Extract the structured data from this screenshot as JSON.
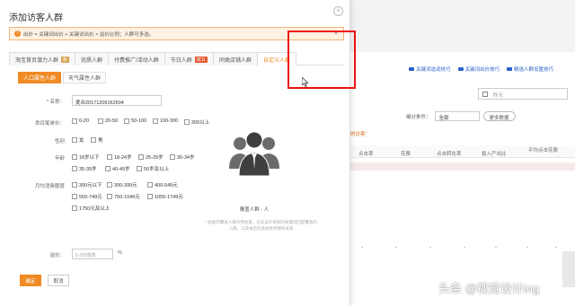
{
  "modal": {
    "title": "添加访客人群",
    "close": "×",
    "warning": {
      "text": "出价 = 关键词出价 + 关键词出价 × 溢价比例；人群可多选。",
      "close": "×"
    },
    "tabs": [
      {
        "label": "淘宝首页潜力人群",
        "badge": "新"
      },
      {
        "label": "优质人群",
        "badge": ""
      },
      {
        "label": "付费推广/活动人群",
        "badge": ""
      },
      {
        "label": "节日人群",
        "badge": "双11"
      },
      {
        "label": "同类店铺人群",
        "badge": ""
      },
      {
        "label": "自定义人群",
        "badge": ""
      }
    ],
    "subtabs": [
      "人口属性人群",
      "天气属性人群"
    ],
    "form": {
      "name_label": "* 名称：",
      "name_value": "爱众20171209162604",
      "category_price_label": "类目笔单价：",
      "category_price_options": [
        "0-20",
        "20-50",
        "50-100",
        "100-300",
        "300以上"
      ],
      "gender_label": "性别",
      "gender_options": [
        "女",
        "男"
      ],
      "age_label": "年龄",
      "age_options": [
        "18岁以下",
        "18-24岁",
        "25-29岁",
        "30-34岁",
        "35-39岁",
        "40-49岁",
        "50岁及以上"
      ],
      "spend_label": "月均消费额度",
      "spend_options": [
        "300元以下",
        "300-399元",
        "400-549元",
        "550-749元",
        "750-1049元",
        "1050-1749元",
        "1750元及以上"
      ],
      "premium_label": "溢价：",
      "premium_placeholder": "5-300整数",
      "premium_unit": "%"
    },
    "preview": {
      "count_label": "覆盖人群 - 人",
      "hint": "* 此处的覆盖人群为预估值，与您设计添加的关键词匹配覆盖的人群，以及本店的具体条件都有关系"
    },
    "buttons": {
      "ok": "确定",
      "cancel": "取消"
    }
  },
  "background": {
    "tips": [
      "关键词选词技巧",
      "关键词出价技巧",
      "精选人群设置技巧"
    ],
    "date_placeholder": "昨天",
    "filter_label": "细分条件：",
    "filter_value": "全部",
    "more_data": "更多数据",
    "note": "的访客\"",
    "columns": [
      "点击率",
      "花费",
      "点击转化率",
      "投入产出比",
      "平均点击花费"
    ],
    "dashes": [
      "-",
      "-",
      "-",
      "-",
      "-",
      "-",
      "-"
    ]
  },
  "watermark": "头条 @视觉设计ing",
  "colors": {
    "accent": "#f08a24",
    "highlight": "#e11111",
    "link": "#2b62c8"
  }
}
